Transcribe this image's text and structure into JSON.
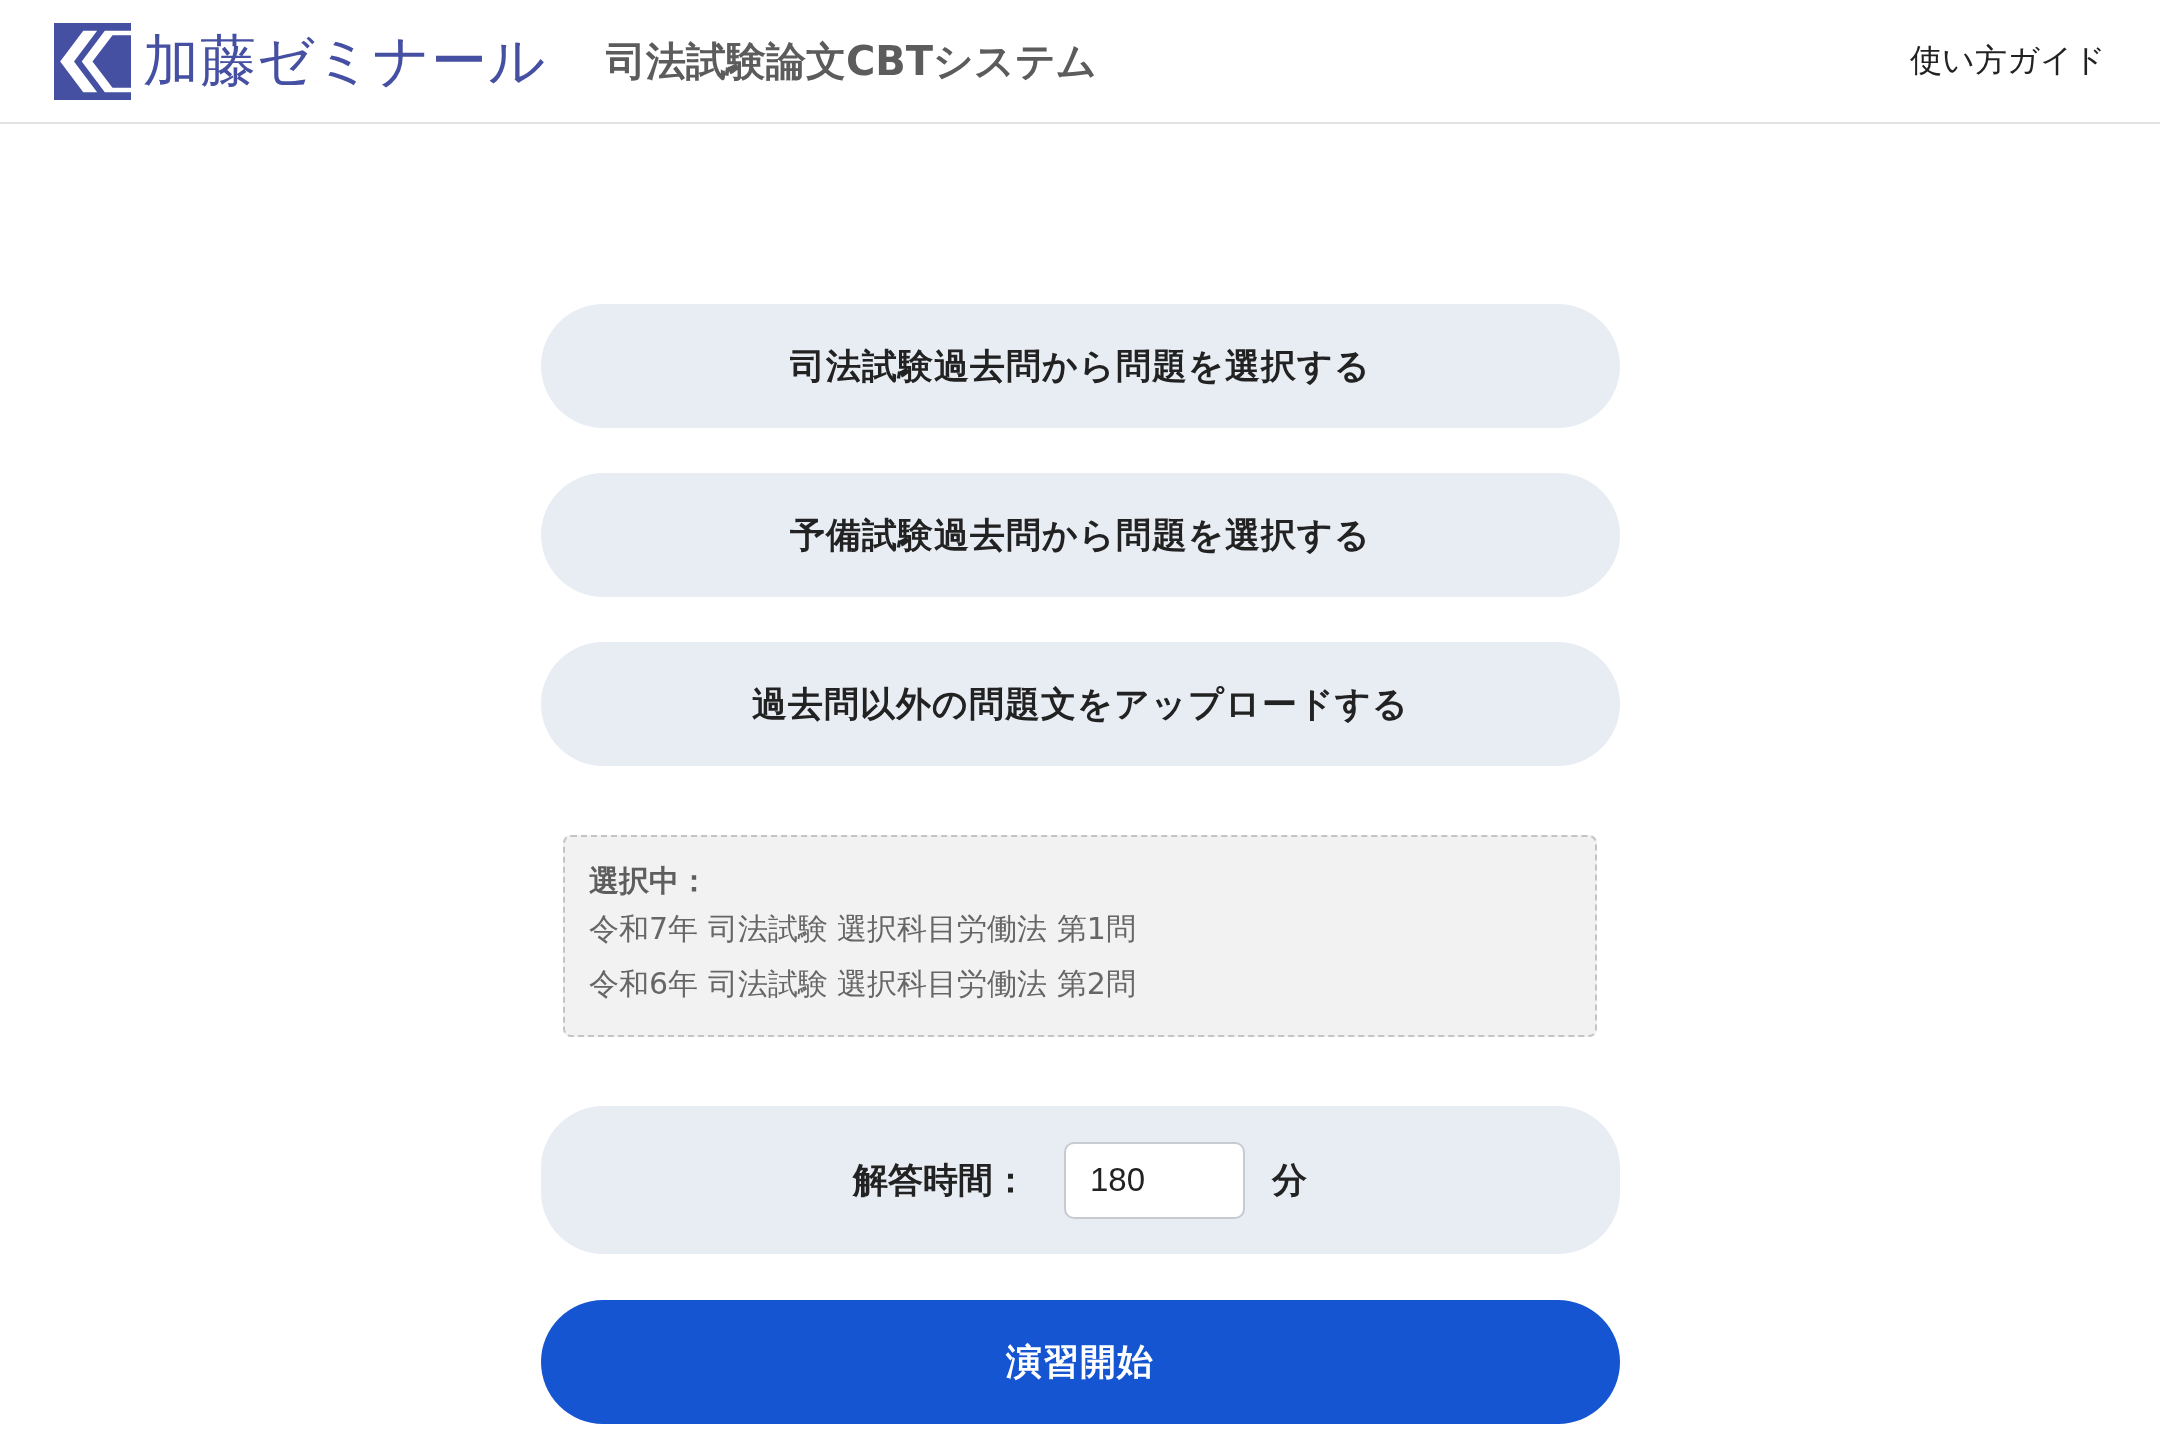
{
  "header": {
    "logo_text": "加藤ゼミナール",
    "title": "司法試験論文CBTシステム",
    "guide_link": "使い方ガイド"
  },
  "source_buttons": [
    "司法試験過去問から問題を選択する",
    "予備試験過去問から問題を選択する",
    "過去問以外の問題文をアップロードする"
  ],
  "selection": {
    "label": "選択中：",
    "items": [
      "令和7年 司法試験 選択科目労働法 第1問",
      "令和6年 司法試験 選択科目労働法 第2問"
    ]
  },
  "answer_time": {
    "label": "解答時間：",
    "value": "180",
    "unit": "分"
  },
  "start_button": "演習開始"
}
